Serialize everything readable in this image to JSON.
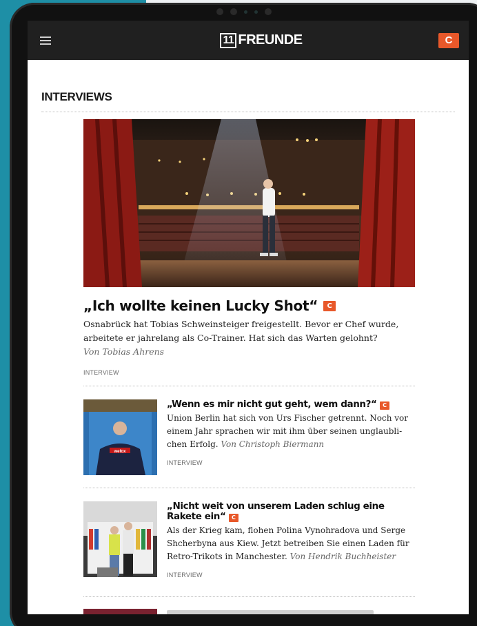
{
  "header": {
    "logo_number": "11",
    "logo_text": "FREUNDE",
    "account_button": "C"
  },
  "section": {
    "title": "INTERVIEWS"
  },
  "hero": {
    "title": "„Ich wollte keinen Lucky Shot“",
    "badge": "C",
    "teaser": "Osnabrück hat Tobias Schweinsteiger freigestellt. Bevor er Chef wurde, arbeitete er jahrelang als Co-Trainer. Hat sich das Warten gelohnt?",
    "byline": "Von Tobias Ahrens",
    "tag": "INTERVIEW"
  },
  "articles": [
    {
      "title": "„Wenn es mir nicht gut geht, wem dann?“",
      "badge": "C",
      "teaser": "Union Berlin hat sich von Urs Fischer getrennt. Noch vor einem Jahr sprachen wir mit ihm über seinen unglaubli­chen Erfolg.",
      "byline": "Von Christoph Biermann",
      "tag": "INTERVIEW"
    },
    {
      "title": "„Nicht weit von unserem Laden schlug eine Rakete ein“",
      "badge": "C",
      "teaser": "Als der Krieg kam, flohen Polina Vynohradova und Serge Shcherbyna aus Kiew. Jetzt betreiben Sie einen Laden für Retro-Trikots in Manchester.",
      "byline": "Von Hendrik Buchheister",
      "tag": "INTERVIEW"
    }
  ]
}
